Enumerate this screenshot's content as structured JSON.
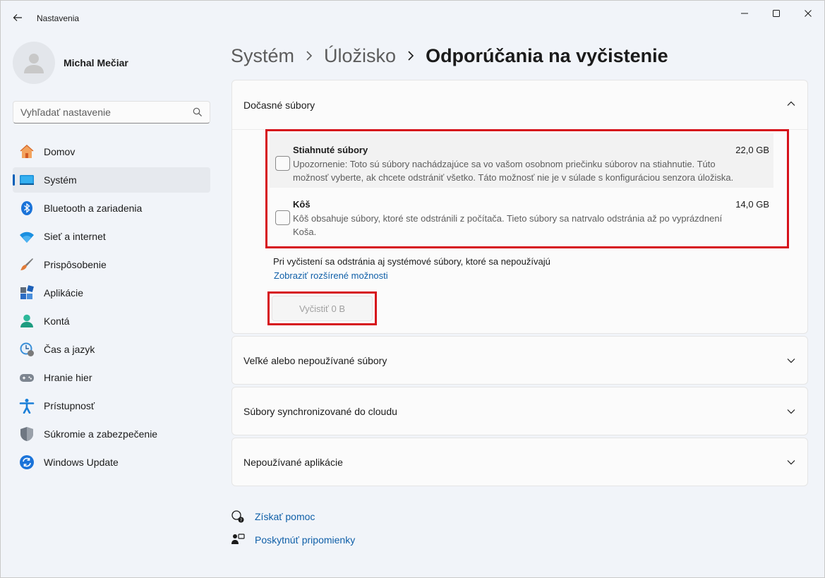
{
  "app": {
    "title": "Nastavenia"
  },
  "icons": {
    "back": "back-arrow-icon",
    "minimize": "minimize-icon",
    "maximize": "maximize-icon",
    "close": "close-icon",
    "search": "search-icon",
    "chevron_up": "chevron-up-icon",
    "chevron_down": "chevron-down-icon"
  },
  "profile": {
    "name": "Michal Mečiar"
  },
  "search": {
    "placeholder": "Vyhľadať nastavenie"
  },
  "sidebar": {
    "items": [
      {
        "label": "Domov",
        "icon": "home-icon",
        "active": false
      },
      {
        "label": "Systém",
        "icon": "system-icon",
        "active": true
      },
      {
        "label": "Bluetooth a zariadenia",
        "icon": "bluetooth-icon",
        "active": false
      },
      {
        "label": "Sieť a internet",
        "icon": "wifi-icon",
        "active": false
      },
      {
        "label": "Prispôsobenie",
        "icon": "brush-icon",
        "active": false
      },
      {
        "label": "Aplikácie",
        "icon": "apps-icon",
        "active": false
      },
      {
        "label": "Kontá",
        "icon": "account-icon",
        "active": false
      },
      {
        "label": "Čas a jazyk",
        "icon": "time-language-icon",
        "active": false
      },
      {
        "label": "Hranie hier",
        "icon": "gaming-icon",
        "active": false
      },
      {
        "label": "Prístupnosť",
        "icon": "accessibility-icon",
        "active": false
      },
      {
        "label": "Súkromie a zabezpečenie",
        "icon": "shield-icon",
        "active": false
      },
      {
        "label": "Windows Update",
        "icon": "windows-update-icon",
        "active": false
      }
    ]
  },
  "breadcrumb": {
    "items": [
      "Systém",
      "Úložisko"
    ],
    "current": "Odporúčania na vyčistenie"
  },
  "temp_files": {
    "header": "Dočasné súbory",
    "rows": [
      {
        "title": "Stiahnuté súbory",
        "size": "22,0 GB",
        "desc_line1": "Upozornenie: Toto sú súbory nachádzajúce sa vo vašom osobnom priečinku súborov na stiahnutie. Túto",
        "desc_line2": "možnosť vyberte, ak chcete odstrániť všetko. Táto možnosť nie je v súlade s konfiguráciou senzora úložiska.",
        "checked": false
      },
      {
        "title": "Kôš",
        "size": "14,0 GB",
        "desc_line1": "Kôš obsahuje súbory, ktoré ste odstránili z počítača. Tieto súbory sa natrvalo odstránia až po vyprázdnení",
        "desc_line2": "Koša.",
        "checked": false
      }
    ],
    "system_note": "Pri vyčistení sa odstránia aj systémové súbory, ktoré sa nepoužívajú",
    "advanced_link": "Zobraziť rozšírené možnosti",
    "clean_button": "Vyčistiť 0 B"
  },
  "sections": [
    {
      "label": "Veľké alebo nepoužívané súbory"
    },
    {
      "label": "Súbory synchronizované do cloudu"
    },
    {
      "label": "Nepoužívané aplikácie"
    }
  ],
  "help": {
    "get_help": "Získať pomoc",
    "feedback": "Poskytnúť pripomienky"
  },
  "colors": {
    "accent": "#005fb8",
    "link": "#0f5fa8",
    "highlight_border": "#d6121b"
  }
}
